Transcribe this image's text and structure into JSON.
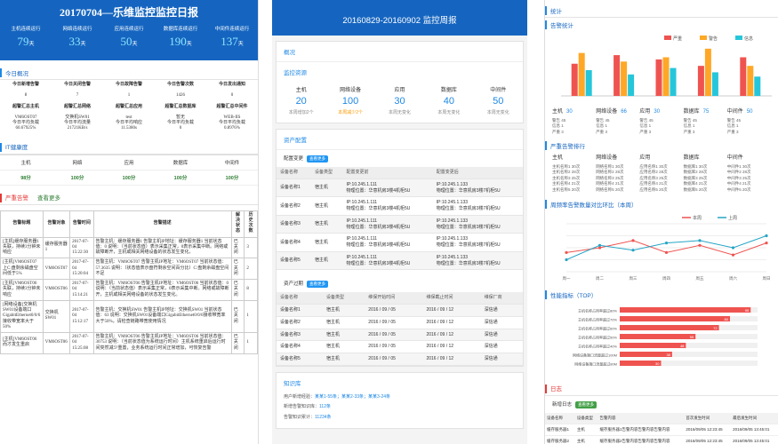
{
  "p1": {
    "title": "20170704—乐维监控监控日报",
    "kpis": [
      {
        "label": "主机连续运行",
        "value": "79",
        "unit": "天"
      },
      {
        "label": "网络连续运行",
        "value": "33",
        "unit": "天"
      },
      {
        "label": "应用连续运行",
        "value": "50",
        "unit": "天"
      },
      {
        "label": "数据库连续运行",
        "value": "190",
        "unit": "天"
      },
      {
        "label": "中间件连续运行",
        "value": "137",
        "unit": "天"
      }
    ],
    "today_title": "今日概况",
    "today_h1": [
      "今日新增告警",
      "今日关闭告警",
      "今日故障告警",
      "今日告警次数",
      "今日发出通知"
    ],
    "today_v1": [
      "8",
      "7",
      "1",
      "1426",
      "0"
    ],
    "today_h2": [
      "超警汇总主机",
      "超警汇总网络",
      "超警汇总应用",
      "超警汇总数据库",
      "超警汇总中间件"
    ],
    "today_v2": [
      "VM6OST07\n今日平均负载\n60.67925%",
      "交换机SW01\n今日平均流量\n21721KB/s",
      "test\n今日平均响应\n11.5380s",
      "暂无\n今日平均负载\n0",
      "WEB-IIS\n今日平均负载\n0.8976%"
    ],
    "health_title": "IT健康度",
    "health_h": [
      "主机",
      "网络",
      "应用",
      "数据库",
      "中间件"
    ],
    "health_v": [
      "98分",
      "100分",
      "100分",
      "100分",
      "100分"
    ],
    "alert_title": "严重告警",
    "alert_more": "查看更多",
    "alert_cols": [
      "告警标题",
      "告警对象",
      "告警时间",
      "告警描述",
      "解决状态",
      "历史次数"
    ],
    "alerts": [
      [
        "[主机]缓存服务器1失联，持续3分钟未响应",
        "缓存服务器1",
        "2017-07-04 15:22:30",
        "告警主机：缓存服务器1 告警主机IP地址：缓存服务器1 当前状态值：0 说明：（当前状态值）表示采集正常，0表示采集中断。网络或故障断开，主机或相关网络设备的状态发生变化。",
        "已关闭",
        "3"
      ],
      [
        "[主机]VM6OST07上C:盘剩余磁盘空间低于5%",
        "VM6OST07",
        "2017-07-04 15:20:04",
        "告警主机：VM6OST07 告警主机IP地址：VM6OST07 当前状态值：57.3635 说明：（状态值表示盘符剩余空间百分比）C:盘剩余磁盘空间不足",
        "已关闭",
        "2"
      ],
      [
        "[主机]VM6OST06失联，持续3分钟未响应",
        "VM6OST06",
        "2017-07-04 15:14:21",
        "告警主机：VM6OST06 告警主机IP地址：VM6OST06 当前状态值：0 说明：（当前状态值）表示采集正常，0表示采集中断。网络或故障断开，主机或相关网络设备的状态发生变化。",
        "已关闭",
        "8"
      ],
      [
        "[网络设备]交换机SW01设备端口GigabitEthernet0/0/6接收带宽率大于50%",
        "交换机SW01",
        "2017-07-04 15:12:17",
        "告警主机：交换机SW01 告警主机IP地址：交换机SW01 当前状态值：63 说明：交换机SW01设备端口GigabitEthernet0/0/6接收带宽率大于50%，请检查链路带宽使用情况",
        "已关闭",
        "1"
      ],
      [
        "[主机]VM6OST06 而才发生重启",
        "VM6OST06",
        "2017-07-04 15:25:08",
        "告警主机：VM6OST06 告警主机IP地址：VM6OST06 当前状态值：30753 说明：（当前状态值为系统运行时间）主机系统重启后运行时间突然减少重置，业务系统运行时间正常增加，可恢复告警",
        "已关闭",
        "1"
      ]
    ]
  },
  "p2": {
    "title": "20160829-20160902 监控周报",
    "overview": "概况",
    "resource_title": "监控资源",
    "resources": [
      {
        "name": "主机",
        "value": "20",
        "sub": "本周增加2个",
        "orange": false
      },
      {
        "name": "网络设备",
        "value": "100",
        "sub": "本周减少2个",
        "orange": true
      },
      {
        "name": "应用",
        "value": "30",
        "sub": "本周无变化",
        "orange": false
      },
      {
        "name": "数据库",
        "value": "40",
        "sub": "本周无变化",
        "orange": false
      },
      {
        "name": "中间件",
        "value": "50",
        "sub": "本周无变化",
        "orange": false
      }
    ],
    "asset_title": "资产配置",
    "change_title": "配置变更",
    "change_tag": "查看更多",
    "change_cols": [
      "设备名称",
      "设备类型",
      "配置变更前",
      "配置变更后"
    ],
    "change_rows": [
      [
        "设备名称1",
        "宿主机",
        "IP:10.245.1.111\n物理位置：华意机房3楼4机柜5U",
        "IP:10.245.1.133\n物理位置：华意机房3楼7机柜5U"
      ],
      [
        "设备名称2",
        "宿主机",
        "IP:10.245.1.111\n物理位置：华意机房3楼4机柜5U",
        "IP:10.245.1.133\n物理位置：华意机房3楼7机柜5U"
      ],
      [
        "设备名称3",
        "宿主机",
        "IP:10.245.1.111\n物理位置：华意机房3楼4机柜5U",
        "IP:10.245.1.133\n物理位置：华意机房3楼7机柜5U"
      ],
      [
        "设备名称4",
        "宿主机",
        "IP:10.245.1.111\n物理位置：华意机房3楼4机柜5U",
        "IP:10.245.1.133\n物理位置：华意机房3楼7机柜5U"
      ],
      [
        "设备名称5",
        "宿主机",
        "IP:10.245.1.111\n物理位置：华意机房3楼4机柜5U",
        "IP:10.245.1.133\n物理位置：华意机房3楼7机柜5U"
      ]
    ],
    "warranty_title": "资产过期",
    "warranty_tag": "查看更多",
    "warranty_cols": [
      "设备名称",
      "设备类型",
      "维保开始时间",
      "维保截止时间",
      "维保厂商"
    ],
    "warranty_rows": [
      [
        "设备名称1",
        "宿主机",
        "2016 / 09 / 05",
        "2016 / 09 / 12",
        "深信通"
      ],
      [
        "设备名称2",
        "宿主机",
        "2016 / 09 / 05",
        "2016 / 09 / 12",
        "深信通"
      ],
      [
        "设备名称3",
        "宿主机",
        "2016 / 09 / 05",
        "2016 / 09 / 12",
        "深信通"
      ],
      [
        "设备名称4",
        "宿主机",
        "2016 / 09 / 05",
        "2016 / 09 / 12",
        "深信通"
      ],
      [
        "设备名称5",
        "宿主机",
        "2016 / 09 / 05",
        "2016 / 09 / 12",
        "深信通"
      ]
    ],
    "kb_title": "知识库",
    "kb_lines": [
      {
        "label": "用户新增经验：",
        "value": "某某1-55条；某某2-33条；某某3-24条"
      },
      {
        "label": "新增告警知识库：",
        "value": "112条"
      },
      {
        "label": "告警知识累计：",
        "value": "11234条"
      }
    ]
  },
  "p3": {
    "section_stats": "统计",
    "alarm_stats": "告警统计",
    "legend": [
      "严重",
      "警告",
      "信息"
    ],
    "chart_data": [
      {
        "type": "bar",
        "categories": [
          "主机",
          "网络设备",
          "应用",
          "数据库",
          "中间件"
        ],
        "ylim": [
          0,
          120
        ],
        "series": [
          {
            "name": "严重",
            "color": "#ef5350",
            "values": [
              75,
              95,
              85,
              70,
              90
            ]
          },
          {
            "name": "警告",
            "color": "#ffa726",
            "values": [
              100,
              80,
              90,
              110,
              70
            ]
          },
          {
            "name": "信息",
            "color": "#26c6da",
            "values": [
              60,
              50,
              65,
              55,
              45
            ]
          }
        ]
      },
      {
        "type": "line",
        "categories": [
          "周一",
          "周二",
          "周三",
          "周四",
          "周五",
          "周六",
          "周日"
        ],
        "ylim": [
          0,
          100
        ],
        "series": [
          {
            "name": "本周",
            "color": "#ef5350",
            "values": [
              40,
              50,
              65,
              40,
              55,
              35,
              60
            ]
          },
          {
            "name": "上周",
            "color": "#26a5c6",
            "values": [
              25,
              55,
              45,
              60,
              65,
              50,
              75
            ]
          }
        ]
      },
      {
        "type": "bar",
        "categories": [
          "主机名称占用率超过80%",
          "主机名称占用率超过70%",
          "主机名称占用率超过60%",
          "主机名称占用率超过50%",
          "主机名称占用率超过40%",
          "网络设备端口流量超过100M",
          "网络设备端口流量超过80M"
        ],
        "ylim": [
          0,
          100
        ],
        "series": [
          {
            "name": "",
            "color": "#ef5350",
            "values": [
              95,
              80,
              72,
              55,
              48,
              38,
              30
            ]
          }
        ]
      }
    ],
    "bar_labels": [
      {
        "name": "主机",
        "value": "30",
        "l1": "警告 45",
        "l2": "信息 1",
        "l3": "严重 3"
      },
      {
        "name": "网络设备",
        "value": "66",
        "l1": "警告 45",
        "l2": "信息 1",
        "l3": "严重 3"
      },
      {
        "name": "应用",
        "value": "30",
        "l1": "警告 45",
        "l2": "信息 1",
        "l3": "严重 3"
      },
      {
        "name": "数据库",
        "value": "75",
        "l1": "警告 45",
        "l2": "信息 1",
        "l3": "严重 3"
      },
      {
        "name": "中间件",
        "value": "50",
        "l1": "警告 45",
        "l2": "信息 1",
        "l3": "严重 3"
      }
    ],
    "rank_title": "严重告警排行",
    "rank_cols": [
      {
        "h": "主机",
        "items": [
          "主机名称1 30次",
          "主机名称2 28次",
          "主机名称3 25次",
          "主机名称4 21次",
          "主机名称5 20次"
        ]
      },
      {
        "h": "网络设备",
        "items": [
          "网络名称1 30次",
          "网络名称2 28次",
          "网络名称3 25次",
          "网络名称4 21次",
          "网络名称5 20次"
        ]
      },
      {
        "h": "应用",
        "items": [
          "应用名称1 30次",
          "应用名称2 28次",
          "应用名称3 25次",
          "应用名称4 21次",
          "应用名称5 20次"
        ]
      },
      {
        "h": "数据库",
        "items": [
          "数据库1 30次",
          "数据库2 28次",
          "数据库3 25次",
          "数据库4 21次",
          "数据库5 20次"
        ]
      },
      {
        "h": "中间件",
        "items": [
          "中间件1 30次",
          "中间件2 28次",
          "中间件3 25次",
          "中间件4 21次",
          "中间件5 20次"
        ]
      }
    ],
    "trend_title": "周频率告警数量对比环比（本周）",
    "perf_title": "性能指标（TOP）",
    "logs_title": "日志",
    "logs_sub": "新增日志",
    "logs_tag": "查看更多",
    "log_cols": [
      "设备名称",
      "设备类型",
      "告警内容",
      "首次发生时间",
      "最后发生时间"
    ],
    "log_rows": [
      [
        "缓存服务器1",
        "主机",
        "缓存服务器1告警内容告警内容告警内容",
        "2016/09/05 12:23:45",
        "2016/09/05 13:45:01"
      ],
      [
        "缓存服务器2",
        "主机",
        "缓存服务器2告警内容告警内容告警内容",
        "2016/09/05 12:23:45",
        "2016/09/05 13:45:01"
      ]
    ]
  }
}
